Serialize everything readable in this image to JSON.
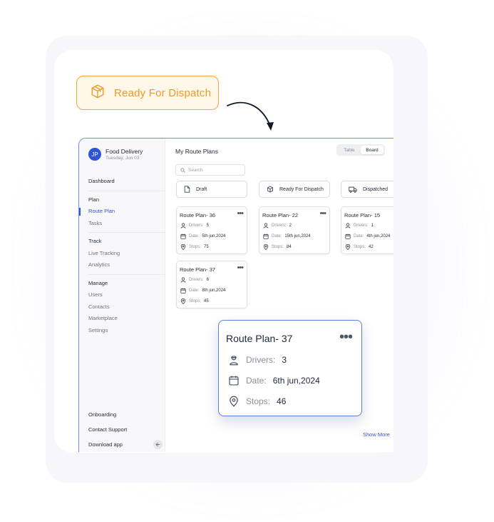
{
  "badge": {
    "label": "Ready For Dispatch",
    "icon": "box-icon",
    "color": "#ee9a2b"
  },
  "profile": {
    "initials": "JP",
    "name": "Food Delivery",
    "date": "Tuesday, Jun 03"
  },
  "sidebar": {
    "dashboard": "Dashboard",
    "plan_section": "Plan",
    "route_plan": "Route Plan",
    "tasks": "Tasks",
    "track_section": "Track",
    "live_tracking": "Live Tracking",
    "analytics": "Analytics",
    "manage_section": "Manage",
    "users": "Users",
    "contacts": "Contacts",
    "marketplace": "Marketplace",
    "settings": "Settings",
    "onboarding": "Onboarding",
    "contact_support": "Contact Support",
    "download_app": "Download app"
  },
  "main": {
    "title": "My Route Plans",
    "view_toggle": {
      "table": "Table",
      "board": "Board",
      "selected": "Board"
    },
    "search_placeholder": "Search",
    "columns": [
      {
        "label": "Draft",
        "icon": "draft-icon"
      },
      {
        "label": "Ready For Dispatch",
        "icon": "box-icon"
      },
      {
        "label": "Dispatched",
        "icon": "truck-icon"
      }
    ],
    "cards": [
      {
        "title": "Route Plan- 36",
        "drivers_label": "Drivers:",
        "drivers": "5",
        "date_label": "Date:",
        "date": "5th jun,2024",
        "stops_label": "Stops:",
        "stops": "75"
      },
      {
        "title": "Route Plan- 37",
        "drivers_label": "Drivers:",
        "drivers": "6",
        "date_label": "Date:",
        "date": "8th jun,2024",
        "stops_label": "Stops:",
        "stops": "45"
      },
      {
        "title": "Route Plan- 22",
        "drivers_label": "Drivers:",
        "drivers": "2",
        "date_label": "Date:",
        "date": "15th jun,2024",
        "stops_label": "Stops:",
        "stops": "84"
      },
      {
        "title": "Route Plan- 15",
        "drivers_label": "Drivers:",
        "drivers": "1",
        "date_label": "Date:",
        "date": "4th jun,2024",
        "stops_label": "Stops:",
        "stops": "42"
      }
    ],
    "card_menu": "•••",
    "show_more": "Show More"
  },
  "dragged_card": {
    "title": "Route Plan- 37",
    "drivers_label": "Drivers:",
    "drivers": "3",
    "date_label": "Date:",
    "date": "6th jun,2024",
    "stops_label": "Stops:",
    "stops": "46",
    "menu": "•••"
  },
  "colors": {
    "accent": "#2f55d4",
    "badge_orange": "#ee9a2b",
    "card_border_active": "#5a7fe0"
  }
}
